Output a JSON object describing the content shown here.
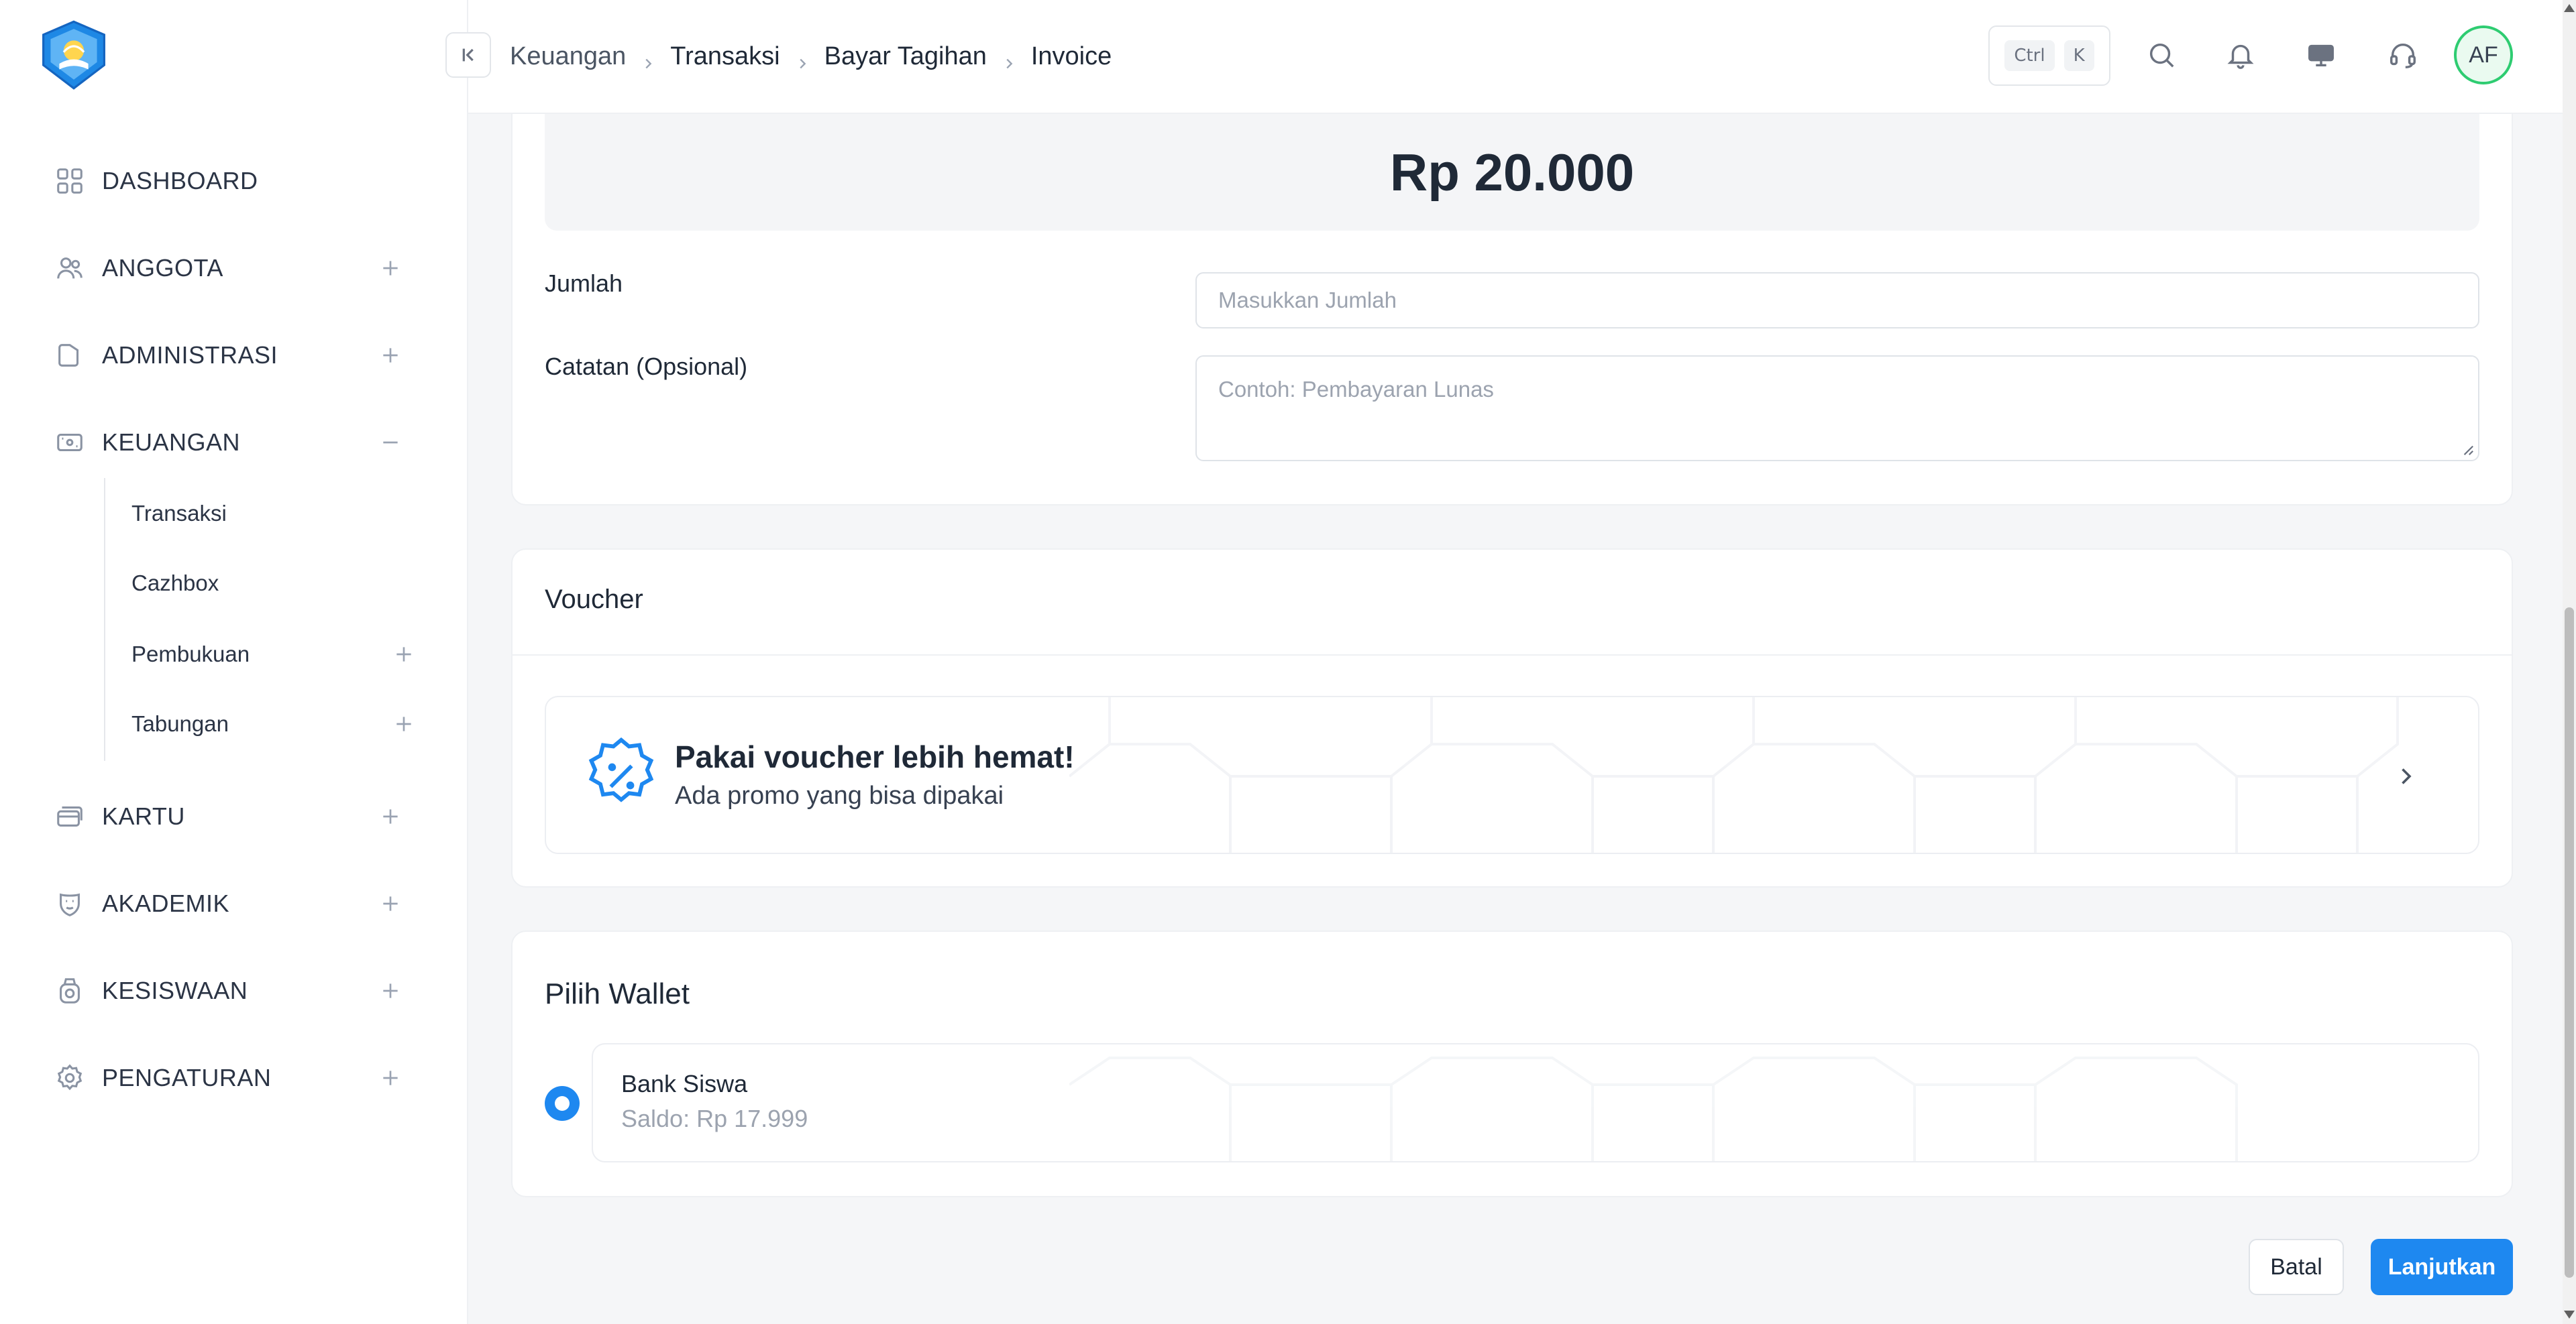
{
  "sidebar": {
    "items": [
      {
        "label": "DASHBOARD",
        "icon": "grid-icon"
      },
      {
        "label": "ANGGOTA",
        "icon": "users-icon"
      },
      {
        "label": "ADMINISTRASI",
        "icon": "folder-icon"
      },
      {
        "label": "KEUANGAN",
        "icon": "wallet-icon"
      },
      {
        "label": "KARTU",
        "icon": "cards-icon"
      },
      {
        "label": "AKADEMIK",
        "icon": "mask-icon"
      },
      {
        "label": "KESISWAAN",
        "icon": "badge-icon"
      },
      {
        "label": "PENGATURAN",
        "icon": "gear-icon"
      }
    ],
    "keuangan_sub": [
      {
        "label": "Transaksi"
      },
      {
        "label": "Cazhbox"
      },
      {
        "label": "Pembukuan"
      },
      {
        "label": "Tabungan"
      }
    ]
  },
  "header": {
    "breadcrumb": [
      "Keuangan",
      "Transaksi",
      "Bayar Tagihan",
      "Invoice"
    ],
    "shortcut": {
      "key1": "Ctrl",
      "key2": "K"
    },
    "avatar_initials": "AF"
  },
  "payment": {
    "amount": "Rp 20.000",
    "jumlah_label": "Jumlah",
    "jumlah_placeholder": "Masukkan Jumlah",
    "catatan_label": "Catatan (Opsional)",
    "catatan_placeholder": "Contoh: Pembayaran Lunas"
  },
  "voucher": {
    "section_title": "Voucher",
    "title": "Pakai voucher lebih hemat!",
    "subtitle": "Ada promo yang bisa dipakai"
  },
  "wallet": {
    "section_title": "Pilih Wallet",
    "options": [
      {
        "name": "Bank Siswa",
        "balance": "Saldo: Rp 17.999",
        "selected": true
      }
    ]
  },
  "actions": {
    "cancel": "Batal",
    "next": "Lanjutkan"
  },
  "colors": {
    "primary": "#1e88f0",
    "avatar_ring": "#2ecc71"
  }
}
